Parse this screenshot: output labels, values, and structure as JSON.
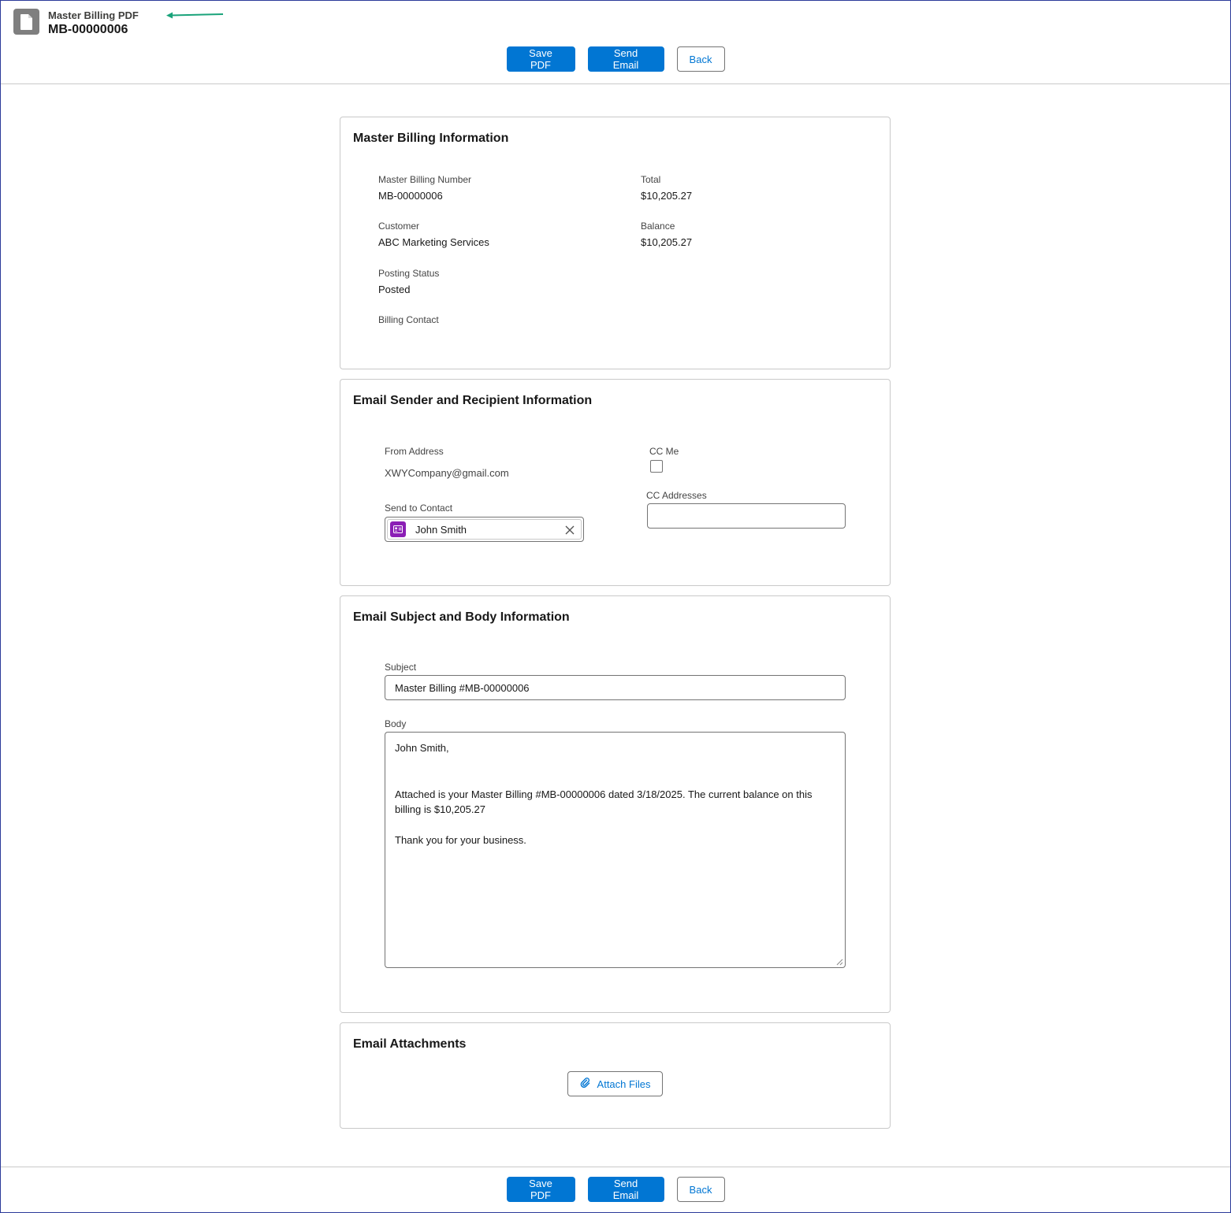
{
  "header": {
    "object_label": "Master Billing PDF",
    "record_name": "MB-00000006",
    "icon": "document-icon"
  },
  "toolbar": {
    "save_label": "Save PDF",
    "send_label": "Send Email",
    "back_label": "Back"
  },
  "billing_info": {
    "title": "Master Billing Information",
    "fields": {
      "number_label": "Master Billing Number",
      "number_value": "MB-00000006",
      "customer_label": "Customer",
      "customer_value": "ABC Marketing Services",
      "status_label": "Posting Status",
      "status_value": "Posted",
      "contact_label": "Billing Contact",
      "total_label": "Total",
      "total_value": "$10,205.27",
      "balance_label": "Balance",
      "balance_value": "$10,205.27"
    }
  },
  "email_sender": {
    "title": "Email Sender and Recipient Information",
    "from_label": "From Address",
    "from_value": "XWYCompany@gmail.com",
    "send_to_label": "Send to Contact",
    "send_to_value": "John Smith",
    "cc_me_label": "CC Me",
    "cc_me_checked": false,
    "cc_addresses_label": "CC Addresses",
    "cc_addresses_value": ""
  },
  "email_body": {
    "title": "Email Subject and Body Information",
    "subject_label": "Subject",
    "subject_value": "Master Billing #MB-00000006",
    "body_label": "Body",
    "body_greeting": "John Smith,",
    "body_line1": "Attached is your Master Billing #MB-00000006 dated 3/18/2025. The current balance on this",
    "body_line2": "billing is $10,205.27",
    "body_closing": "Thank you for your business."
  },
  "attachments": {
    "title": "Email Attachments",
    "attach_label": "Attach Files"
  },
  "colors": {
    "brand": "#0176d3",
    "annotation_arrow": "#1aa37a",
    "contact_icon": "#8b1fb5"
  }
}
